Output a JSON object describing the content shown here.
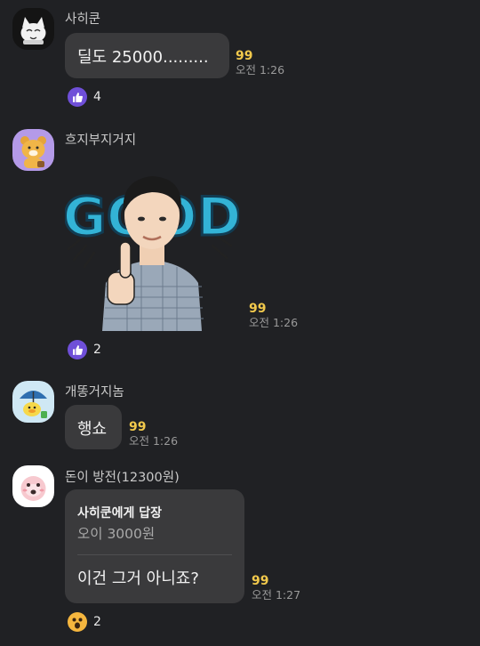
{
  "messages": [
    {
      "sender": "사히쿤",
      "text": "딜도 25000.........",
      "unread": "99",
      "time": "오전 1:26",
      "reaction": {
        "icon": "thumbs-up-icon",
        "count": "4"
      }
    },
    {
      "sender": "흐지부지거지",
      "sticker": {
        "word": "GOOD"
      },
      "unread": "99",
      "time": "오전 1:26",
      "reaction": {
        "icon": "thumbs-up-icon",
        "count": "2"
      }
    },
    {
      "sender": "개똥거지놈",
      "text": "행쇼",
      "unread": "99",
      "time": "오전 1:26"
    },
    {
      "sender": "돈이 방전(12300원)",
      "reply": {
        "title": "사히쿤에게 답장",
        "quoted": "오이 3000원"
      },
      "text": "이건 그거 아니죠?",
      "unread": "99",
      "time": "오전 1:27",
      "reaction": {
        "icon": "surprised-face-icon",
        "count": "2"
      }
    }
  ],
  "colors": {
    "background": "#202124",
    "bubble": "#3a3a3c",
    "unread": "#f2c94c",
    "like": "#6f4fd8"
  }
}
